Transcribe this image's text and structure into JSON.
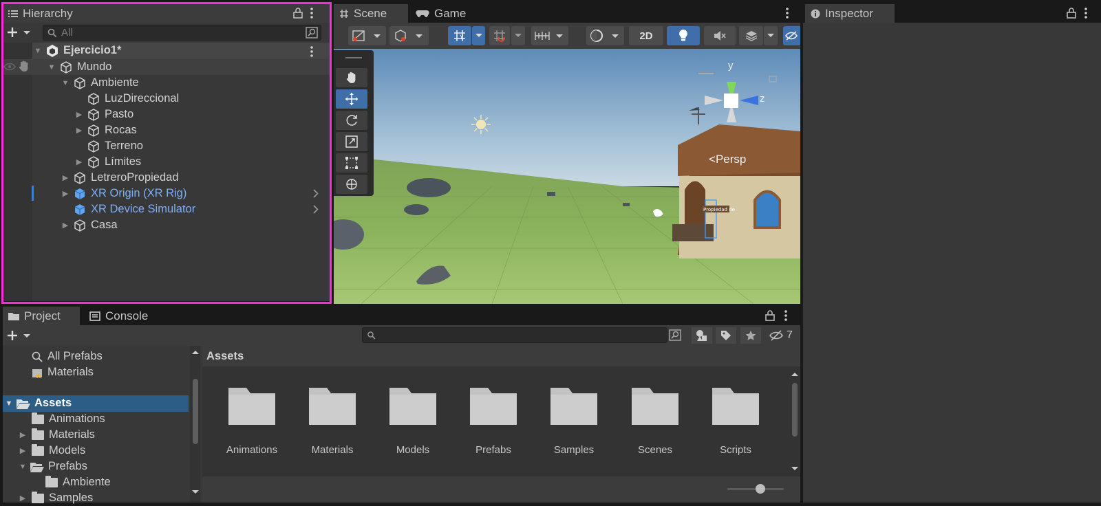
{
  "hierarchy": {
    "tab_label": "Hierarchy",
    "search_placeholder": "All",
    "scene_name": "Ejercicio1*",
    "items": [
      {
        "label": "Mundo"
      },
      {
        "label": "Ambiente"
      },
      {
        "label": "LuzDireccional"
      },
      {
        "label": "Pasto"
      },
      {
        "label": "Rocas"
      },
      {
        "label": "Terreno"
      },
      {
        "label": "Límites"
      },
      {
        "label": "LetreroPropiedad"
      },
      {
        "label": "XR Origin (XR Rig)"
      },
      {
        "label": "XR Device Simulator"
      },
      {
        "label": "Casa"
      }
    ]
  },
  "scene": {
    "tab_scene": "Scene",
    "tab_game": "Game",
    "btn_2d": "2D",
    "persp_label": "Persp",
    "gizmo_y": "y",
    "gizmo_z": "z",
    "sign_text": "Propiedad de"
  },
  "inspector": {
    "tab_label": "Inspector"
  },
  "project": {
    "tab_project": "Project",
    "tab_console": "Console",
    "hidden_count": "7",
    "breadcrumb": "Assets",
    "tree": [
      {
        "label": "All Prefabs"
      },
      {
        "label": "Materials"
      },
      {
        "label": "Assets"
      },
      {
        "label": "Animations"
      },
      {
        "label": "Materials"
      },
      {
        "label": "Models"
      },
      {
        "label": "Prefabs"
      },
      {
        "label": "Ambiente"
      },
      {
        "label": "Samples"
      }
    ],
    "folders": [
      {
        "label": "Animations"
      },
      {
        "label": "Materials"
      },
      {
        "label": "Models"
      },
      {
        "label": "Prefabs"
      },
      {
        "label": "Samples"
      },
      {
        "label": "Scenes"
      },
      {
        "label": "Scripts"
      }
    ]
  },
  "colors": {
    "highlight_border": "#ff2bd6",
    "accent_blue": "#7faef6",
    "selection": "#2c5d87"
  }
}
